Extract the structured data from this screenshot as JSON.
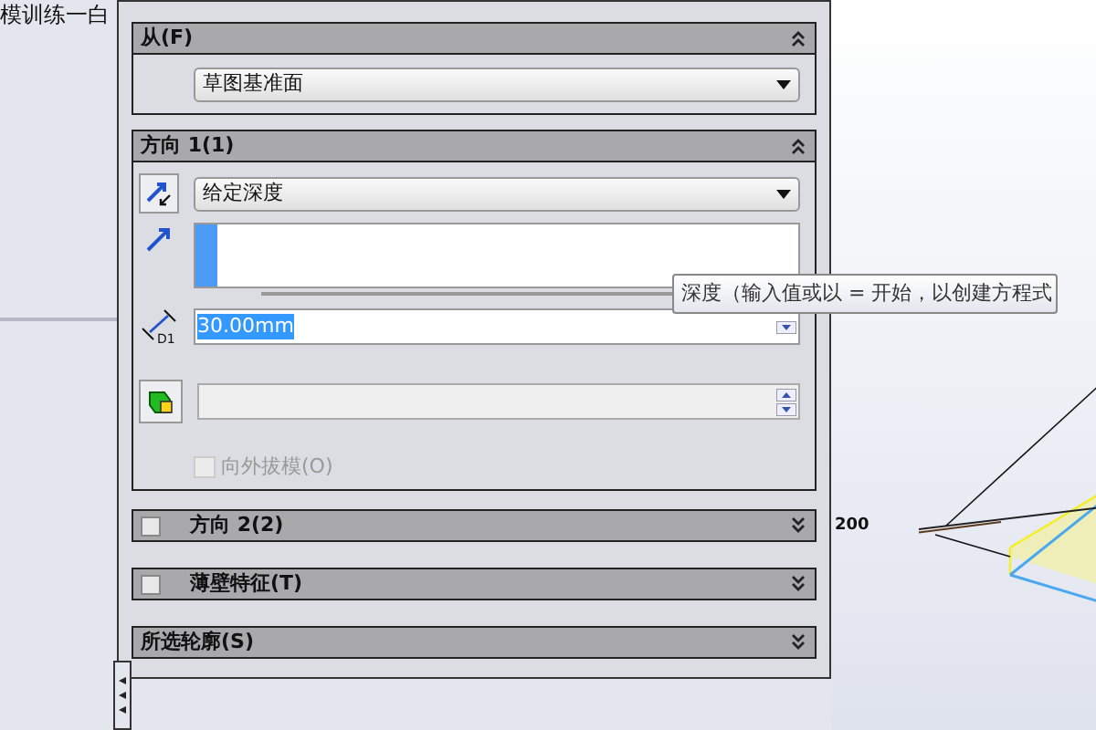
{
  "document_title": "模训练一白",
  "from_section": {
    "title": "从(F)",
    "expanded": true,
    "value": "草图基准面"
  },
  "direction1": {
    "title": "方向 1(1)",
    "expanded": true,
    "end_condition": "给定深度",
    "depth_label": "D1",
    "depth": "30.00mm",
    "draft": {
      "label": "向外拔模(O)",
      "checked": false,
      "disabled": true
    }
  },
  "collapsed_sections": [
    {
      "title": "方向 2(2)",
      "has_checkbox": true,
      "checked": false
    },
    {
      "title": "薄壁特征(T)",
      "has_checkbox": true,
      "checked": false
    },
    {
      "title": "所选轮廓(S)",
      "has_checkbox": false
    }
  ],
  "tooltip": "深度（输入值或以 = 开始，以创建方程式",
  "canvas": {
    "dimension": "200"
  }
}
